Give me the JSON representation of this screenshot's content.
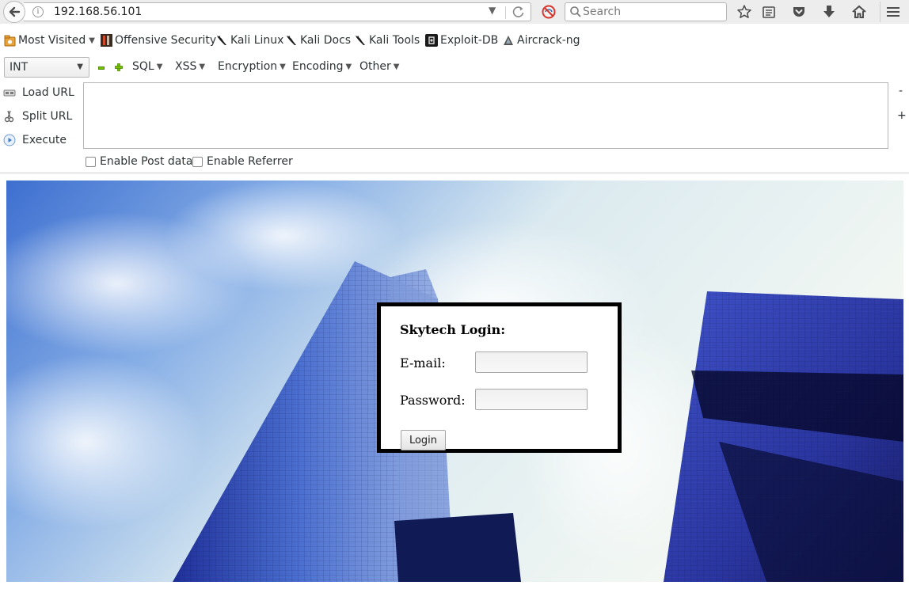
{
  "browser": {
    "url": "192.168.56.101",
    "search_placeholder": "Search",
    "icons": [
      "back-arrow-icon",
      "info-icon",
      "dropdown-arrow-icon",
      "reload-icon",
      "noscript-icon",
      "search-icon",
      "star-icon",
      "reading-list-icon",
      "pocket-icon",
      "download-icon",
      "home-icon",
      "hamburger-menu-icon"
    ]
  },
  "bookmarks": [
    {
      "label": "Most Visited",
      "icon": "most-visited-icon",
      "has_dropdown": true
    },
    {
      "label": "Offensive Security",
      "icon": "offensive-security-icon"
    },
    {
      "label": "Kali Linux",
      "icon": "kali-dragon-icon"
    },
    {
      "label": "Kali Docs",
      "icon": "kali-dragon-icon"
    },
    {
      "label": "Kali Tools",
      "icon": "kali-dragon-icon"
    },
    {
      "label": "Exploit-DB",
      "icon": "exploit-db-icon"
    },
    {
      "label": "Aircrack-ng",
      "icon": "aircrack-icon"
    }
  ],
  "hackbar": {
    "select_value": "INT",
    "menus": [
      "SQL",
      "XSS",
      "Encryption",
      "Encoding",
      "Other"
    ],
    "actions": [
      {
        "label": "Load URL",
        "icon": "load-url-icon"
      },
      {
        "label": "Split URL",
        "icon": "split-url-icon"
      },
      {
        "label": "Execute",
        "icon": "execute-icon"
      }
    ],
    "textarea_value": "",
    "collapse_symbol": "-",
    "expand_symbol": "+",
    "checkboxes": [
      {
        "label": "Enable Post data",
        "checked": false
      },
      {
        "label": "Enable Referrer",
        "checked": false
      }
    ]
  },
  "page": {
    "background": "skyscrapers-photo",
    "login": {
      "title": "Skytech Login:",
      "email_label": "E-mail:",
      "password_label": "Password:",
      "email_value": "",
      "password_value": "",
      "button_label": "Login"
    }
  },
  "colors": {
    "toolbar_bg": "#ededed",
    "sky_light": "#e8f2f0",
    "sky_blue": "#4f7fd0",
    "building_blue": "#2e44b0",
    "login_border": "#000000"
  }
}
